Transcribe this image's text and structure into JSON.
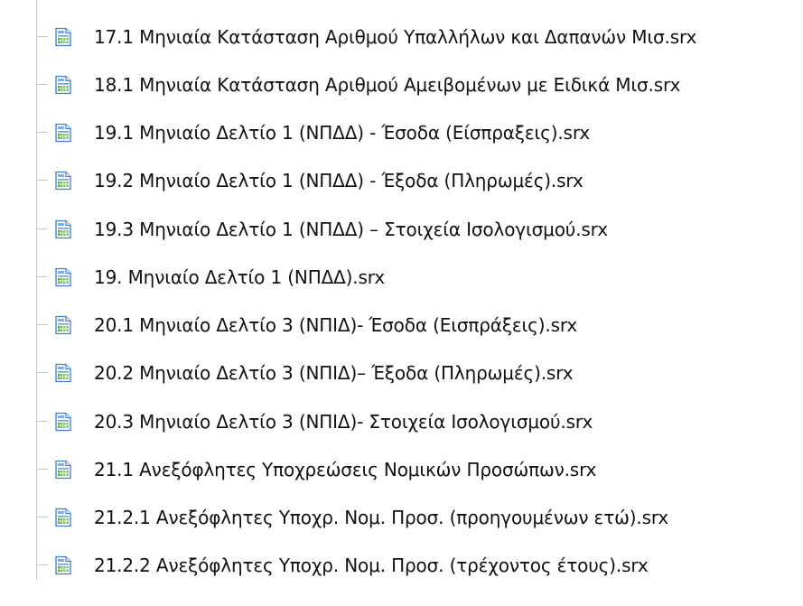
{
  "tree": {
    "items": [
      {
        "label": "17.1 Μηνιαία Κατάσταση Αριθμού Υπαλλήλων και Δαπανών Μισ.srx",
        "icon": "report-file-icon"
      },
      {
        "label": "18.1 Μηνιαία Κατάσταση Αριθμού Αμειβομένων με Ειδικά Μισ.srx",
        "icon": "report-file-icon"
      },
      {
        "label": "19.1 Μηνιαίο Δελτίο 1 (ΝΠΔΔ) - Έσοδα (Είσπραξεις).srx",
        "icon": "report-file-icon"
      },
      {
        "label": "19.2 Μηνιαίο Δελτίο 1 (ΝΠΔΔ) - Έξοδα (Πληρωμές).srx",
        "icon": "report-file-icon"
      },
      {
        "label": "19.3 Μηνιαίο Δελτίο 1 (ΝΠΔΔ) – Στοιχεία Ισολογισμού.srx",
        "icon": "report-file-icon"
      },
      {
        "label": "19. Μηνιαίο Δελτίο 1 (ΝΠΔΔ).srx",
        "icon": "report-file-icon"
      },
      {
        "label": "20.1 Μηνιαίο Δελτίο 3 (ΝΠΙΔ)- Έσοδα (Εισπράξεις).srx",
        "icon": "report-file-icon"
      },
      {
        "label": "20.2 Μηνιαίο Δελτίο 3 (ΝΠΙΔ)– Έξοδα (Πληρωμές).srx",
        "icon": "report-file-icon"
      },
      {
        "label": "20.3 Μηνιαίο Δελτίο 3 (ΝΠΙΔ)- Στοιχεία Ισολογισμού.srx",
        "icon": "report-file-icon"
      },
      {
        "label": "21.1 Ανεξόφλητες Υποχρεώσεις Νομικών Προσώπων.srx",
        "icon": "report-file-icon"
      },
      {
        "label": "21.2.1 Ανεξόφλητες Υποχρ. Νομ. Προσ. (προηγουμένων ετώ).srx",
        "icon": "report-file-icon"
      },
      {
        "label": "21.2.2 Ανεξόφλητες Υποχρ. Νομ. Προσ. (τρέχοντος έτους).srx",
        "icon": "report-file-icon"
      }
    ]
  },
  "colors": {
    "tree_line": "#c7c7c7",
    "text": "#111111",
    "icon_blue": "#3c7fc6",
    "icon_green": "#5aa647"
  }
}
